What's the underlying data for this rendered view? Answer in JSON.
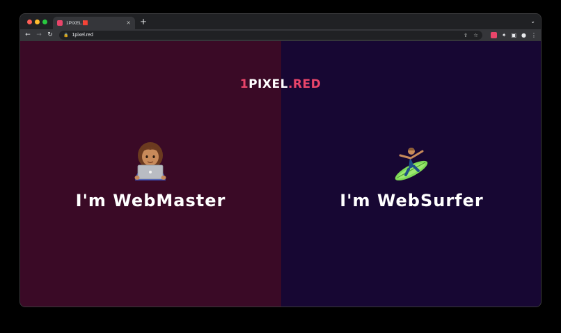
{
  "browser": {
    "tab": {
      "title": "1PIXEL.🟥",
      "close_glyph": "×"
    },
    "new_tab_glyph": "+",
    "tab_search_glyph": "⌄",
    "nav": {
      "back": "←",
      "forward": "→",
      "reload": "↻"
    },
    "address": {
      "url": "1pixel.red",
      "lock_glyph": "🔒"
    },
    "omnibox_icons": {
      "share": "⇪",
      "bookmark": "☆"
    },
    "extensions": {
      "puzzle": "✦",
      "sidebar": "▣",
      "profile": "●",
      "menu": "⋮"
    }
  },
  "page": {
    "logo": {
      "prefix": "1PIXEL",
      "dot": ".",
      "suffix": "RED"
    },
    "left": {
      "caption": "I'm WebMaster",
      "emoji_name": "woman-technologist-icon"
    },
    "right": {
      "caption": "I'm WebSurfer",
      "emoji_name": "surfer-icon"
    }
  },
  "colors": {
    "left_bg": "#3a0a26",
    "right_bg": "#170733",
    "accent": "#e9456a"
  }
}
